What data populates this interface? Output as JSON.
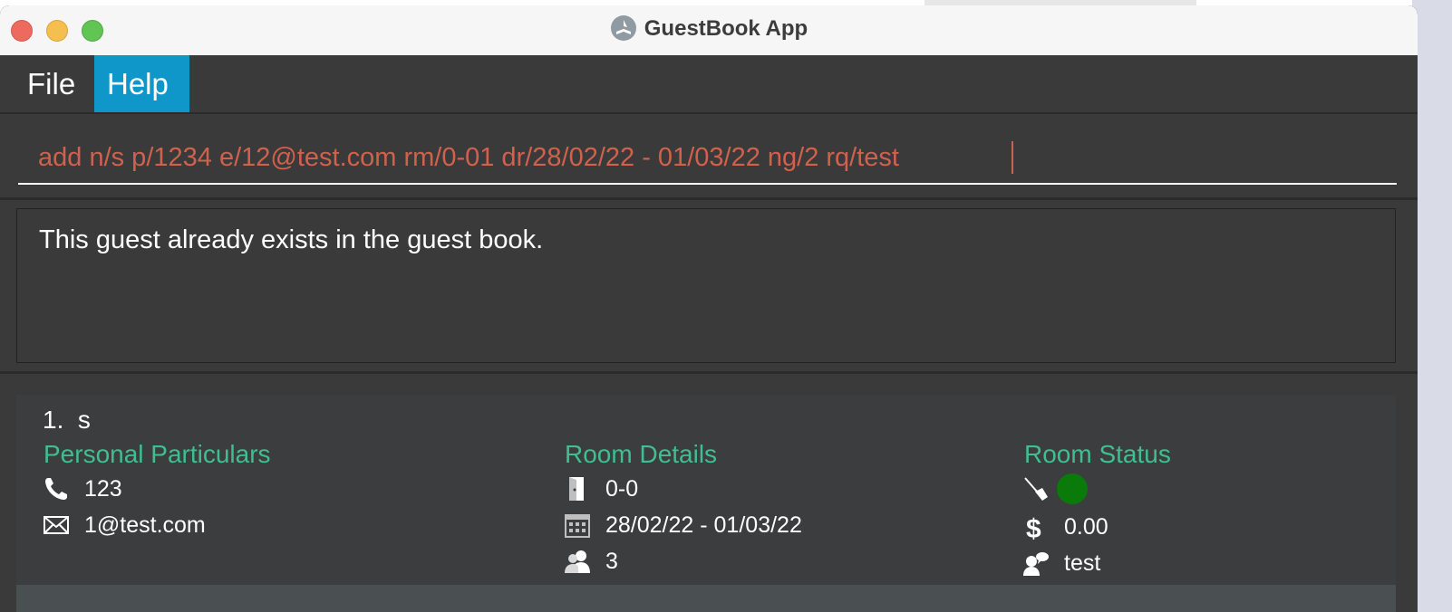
{
  "window": {
    "title": "GuestBook App"
  },
  "menu": {
    "items": [
      {
        "label": "File"
      },
      {
        "label": "Help"
      }
    ]
  },
  "command": {
    "value": "add n/s p/1234 e/12@test.com rm/0-01 dr/28/02/22 - 01/03/22 ng/2 rq/test"
  },
  "result": {
    "message": "This guest already exists in the guest book."
  },
  "guest_list": [
    {
      "index": "1.",
      "name": "s",
      "personal_title": "Personal Particulars",
      "phone": "123",
      "email": "1@test.com",
      "room_title": "Room Details",
      "room": "0-0",
      "date_range": "28/02/22 - 01/03/22",
      "num_guests": "3",
      "status_title": "Room Status",
      "is_clean": true,
      "bill": "0.00",
      "request": "test"
    }
  ],
  "colors": {
    "accent_menu": "#0f97c9",
    "command_text": "#d0614c",
    "section_title": "#3fbf8f",
    "status_clean": "#0a7a0a"
  }
}
